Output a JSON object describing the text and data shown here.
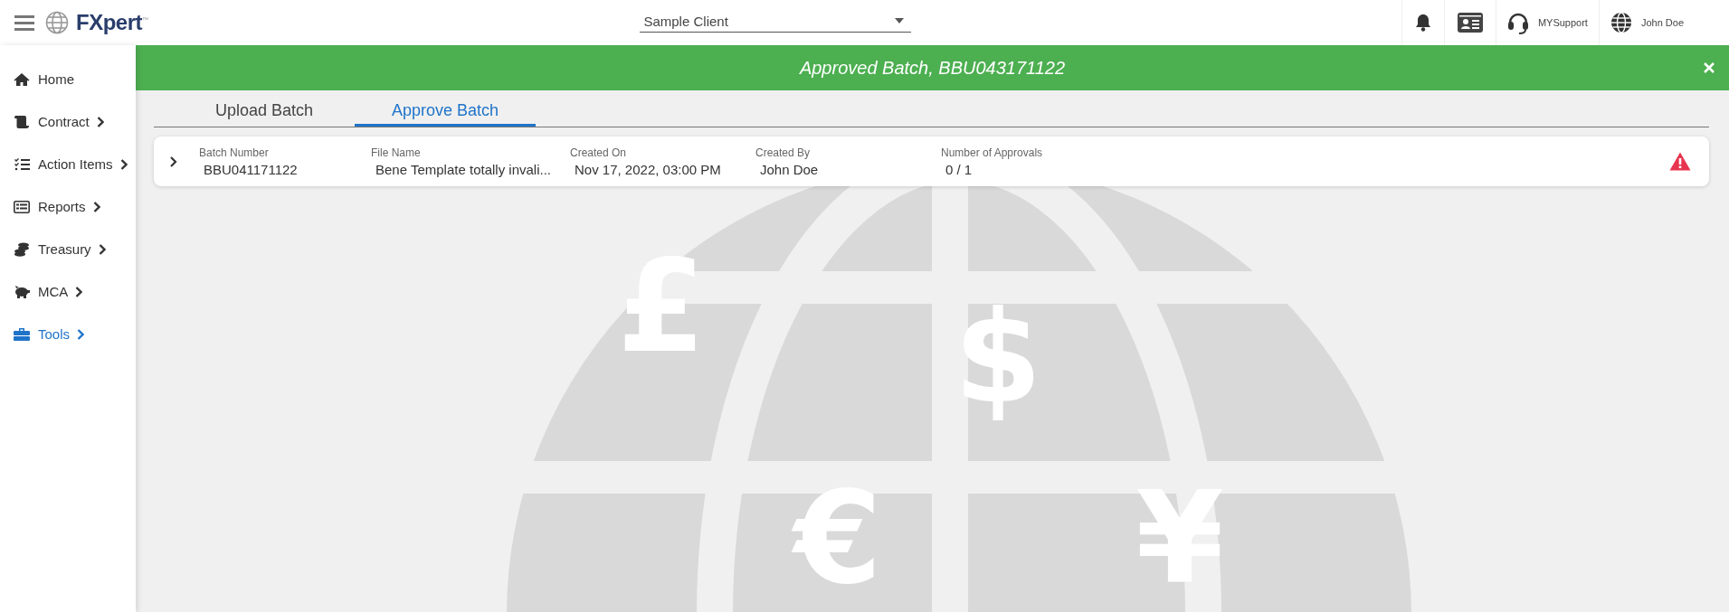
{
  "header": {
    "logo_text": "FXpert",
    "logo_tm": "™",
    "client_select": {
      "value": "Sample Client"
    },
    "support_label": "MYSupport",
    "user_name": "John Doe"
  },
  "sidebar": {
    "items": [
      {
        "label": "Home",
        "has_submenu": false,
        "selected": false
      },
      {
        "label": "Contract",
        "has_submenu": true,
        "selected": false
      },
      {
        "label": "Action Items",
        "has_submenu": true,
        "selected": false
      },
      {
        "label": "Reports",
        "has_submenu": true,
        "selected": false
      },
      {
        "label": "Treasury",
        "has_submenu": true,
        "selected": false
      },
      {
        "label": "MCA",
        "has_submenu": true,
        "selected": false
      },
      {
        "label": "Tools",
        "has_submenu": true,
        "selected": true
      }
    ]
  },
  "banner": {
    "message": "Approved Batch, BBU043171122"
  },
  "tabs": [
    {
      "label": "Upload Batch",
      "selected": false
    },
    {
      "label": "Approve Batch",
      "selected": true
    }
  ],
  "batches": [
    {
      "expanded": false,
      "warning": true,
      "fields": [
        {
          "label": "Batch Number",
          "value": "BBU041171122"
        },
        {
          "label": "File Name",
          "value": "Bene Template totally invali..."
        },
        {
          "label": "Created On",
          "value": "Nov 17, 2022, 03:00 PM"
        },
        {
          "label": "Created By",
          "value": "John Doe"
        },
        {
          "label": "Number of Approvals",
          "value": "0 / 1"
        }
      ]
    }
  ],
  "background_symbols": [
    "£",
    "$",
    "€",
    "¥"
  ]
}
